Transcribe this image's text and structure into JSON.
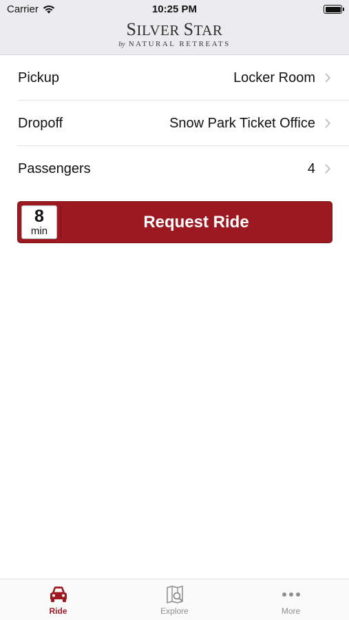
{
  "status_bar": {
    "carrier": "Carrier",
    "time": "10:25 PM",
    "wifi_icon": "wifi-icon",
    "battery_icon": "battery-icon"
  },
  "header": {
    "brand_name_first_big": "S",
    "brand_name_first_rest": "ILVER ",
    "brand_name_second_big": "S",
    "brand_name_second_rest": "TAR",
    "brand_by": "by",
    "brand_sub": "NATURAL RETREATS"
  },
  "rows": [
    {
      "label": "Pickup",
      "value": "Locker Room"
    },
    {
      "label": "Dropoff",
      "value": "Snow Park Ticket Office"
    },
    {
      "label": "Passengers",
      "value": "4"
    }
  ],
  "request": {
    "eta_value": "8",
    "eta_unit": "min",
    "label": "Request Ride"
  },
  "tabbar": {
    "tabs": [
      {
        "label": "Ride",
        "icon": "car-icon",
        "active": true
      },
      {
        "label": "Explore",
        "icon": "map-search-icon",
        "active": false
      },
      {
        "label": "More",
        "icon": "ellipsis-icon",
        "active": false
      }
    ]
  },
  "colors": {
    "accent": "#9c1921",
    "header_bg": "#ececee",
    "inactive_tab": "#8e8e93"
  }
}
